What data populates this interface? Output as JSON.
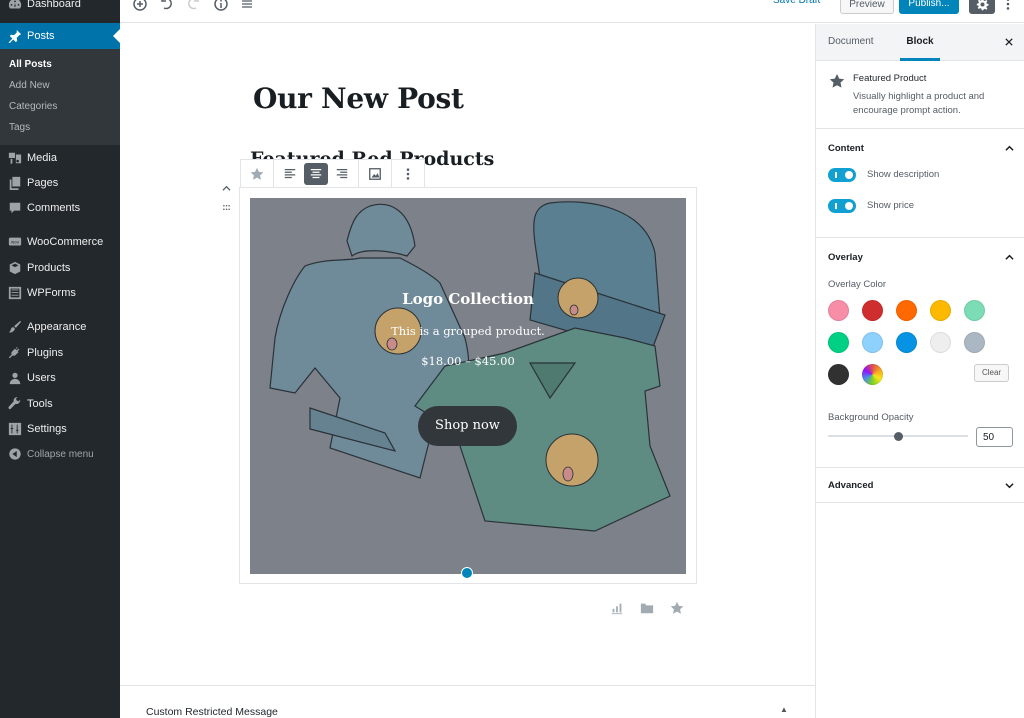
{
  "admin_menu": {
    "items": [
      {
        "label": "Dashboard",
        "icon": "dashboard-icon"
      },
      {
        "label": "Posts",
        "icon": "pin-icon",
        "current": true
      },
      {
        "label": "Media",
        "icon": "media-icon"
      },
      {
        "label": "Pages",
        "icon": "pages-icon"
      },
      {
        "label": "Comments",
        "icon": "comment-icon"
      },
      {
        "label": "WooCommerce",
        "icon": "woo-icon"
      },
      {
        "label": "Products",
        "icon": "box-icon"
      },
      {
        "label": "WPForms",
        "icon": "forms-icon"
      },
      {
        "label": "Appearance",
        "icon": "brush-icon"
      },
      {
        "label": "Plugins",
        "icon": "plug-icon"
      },
      {
        "label": "Users",
        "icon": "user-icon"
      },
      {
        "label": "Tools",
        "icon": "wrench-icon"
      },
      {
        "label": "Settings",
        "icon": "sliders-icon"
      }
    ],
    "submenu": [
      "All Posts",
      "Add New",
      "Categories",
      "Tags"
    ],
    "collapse_label": "Collapse menu"
  },
  "top_bar": {
    "save_draft": "Save Draft",
    "preview": "Preview",
    "publish": "Publish..."
  },
  "editor": {
    "post_title": "Our New Post",
    "heading_block": "Featured Red Products",
    "featured_product": {
      "title": "Logo Collection",
      "description": "This is a grouped product.",
      "price": "$18.00 – $45.00",
      "button_label": "Shop now"
    },
    "meta_box_title": "Custom Restricted Message"
  },
  "settings_panel": {
    "tabs": [
      "Document",
      "Block"
    ],
    "active_tab": "Block",
    "block_card": {
      "title": "Featured Product",
      "description": "Visually highlight a product and encourage prompt action."
    },
    "content_section": {
      "title": "Content",
      "toggles": [
        {
          "label": "Show description",
          "checked": true
        },
        {
          "label": "Show price",
          "checked": true
        }
      ]
    },
    "overlay_section": {
      "title": "Overlay",
      "color_label": "Overlay Color",
      "colors": [
        "#f78da7",
        "#cf2e2e",
        "#ff6900",
        "#fcb900",
        "#7bdcb5",
        "#00d084",
        "#8ed1fc",
        "#0693e3",
        "#eeeeee",
        "#abb8c3",
        "#313131",
        "custom-gradient"
      ],
      "clear_label": "Clear",
      "opacity_label": "Background Opacity",
      "opacity_value": "50",
      "opacity_percent": 50
    },
    "advanced_section": {
      "title": "Advanced"
    }
  },
  "colors": {
    "accent": "#0085ba",
    "admin_bg": "#23282d",
    "admin_current": "#0073aa",
    "toggle_on": "#11a0d2"
  }
}
